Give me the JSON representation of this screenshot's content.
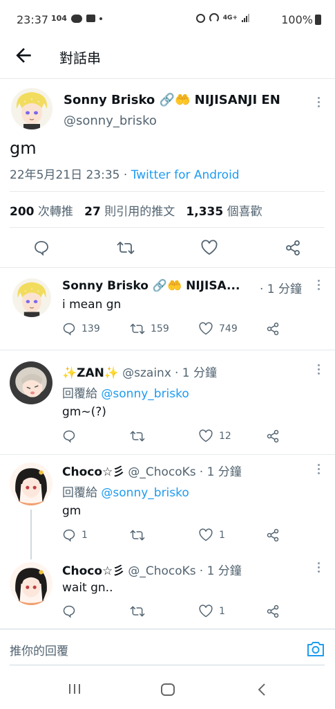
{
  "status_bar": {
    "time": "23:37",
    "extra_left": "104",
    "network": "4G+",
    "battery": "100%"
  },
  "header": {
    "title": "對話串"
  },
  "main_tweet": {
    "name": "Sonny Brisko 🔗🤲 NIJISANJI EN",
    "handle": "@sonny_brisko",
    "text": "gm",
    "datetime": "22年5月21日 23:35",
    "separator": "·",
    "client": "Twitter for Android",
    "retweets_count": "200",
    "retweets_label": "次轉推",
    "quotes_count": "27",
    "quotes_label": "則引用的推文",
    "likes_count": "1,335",
    "likes_label": "個喜歡"
  },
  "replies": [
    {
      "name": "Sonny Brisko 🔗🤲 NIJISA...",
      "handle": "",
      "time": "· 1 分鐘",
      "reply_to_label": "",
      "reply_to_handle": "",
      "text": "i mean gn",
      "replies": "139",
      "retweets": "159",
      "likes": "749"
    },
    {
      "name": "✨ZAN✨",
      "handle": "@szainx",
      "time": "· 1 分鐘",
      "reply_to_label": "回覆給",
      "reply_to_handle": "@sonny_brisko",
      "text": "gm~(?)",
      "replies": "",
      "retweets": "",
      "likes": "12"
    },
    {
      "name": "Choco☆彡",
      "handle": "@_ChocoKs",
      "time": "· 1 分鐘",
      "reply_to_label": "回覆給",
      "reply_to_handle": "@sonny_brisko",
      "text": "gm",
      "replies": "1",
      "retweets": "",
      "likes": "1"
    },
    {
      "name": "Choco☆彡",
      "handle": "@_ChocoKs",
      "time": "· 1 分鐘",
      "reply_to_label": "",
      "reply_to_handle": "",
      "text": "wait gn..",
      "replies": "",
      "retweets": "",
      "likes": "1"
    }
  ],
  "reply_bar": {
    "placeholder": "推你的回覆"
  },
  "icons": {
    "back": "arrow-left-icon",
    "more": "more-vertical-icon",
    "reply": "comment-icon",
    "retweet": "retweet-icon",
    "like": "heart-icon",
    "share": "share-icon",
    "camera": "camera-icon",
    "nav_recents": "recents-icon",
    "nav_home": "home-icon",
    "nav_back": "back-chevron-icon"
  },
  "colors": {
    "link": "#1d9bf0",
    "muted": "#536471",
    "text": "#0f1419"
  }
}
